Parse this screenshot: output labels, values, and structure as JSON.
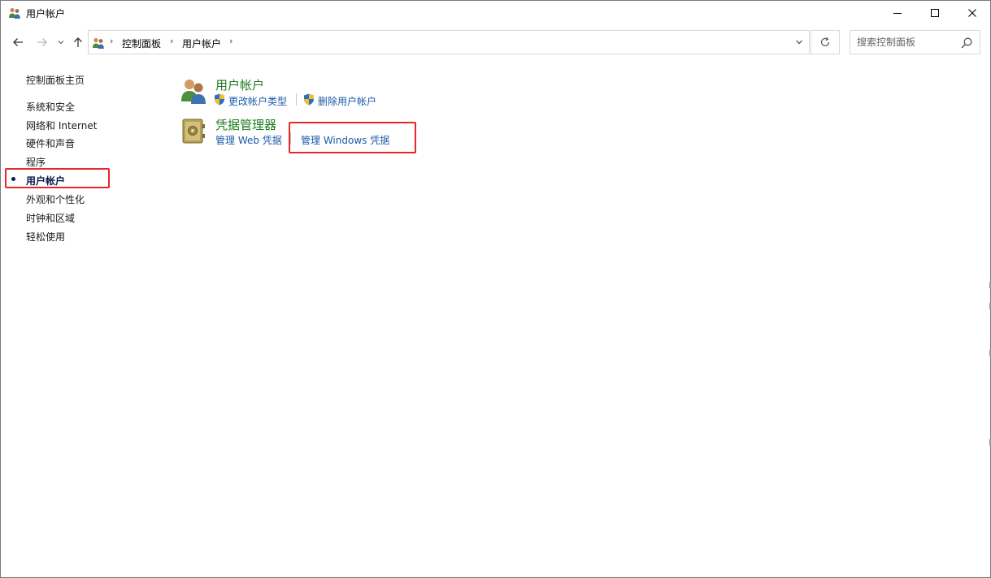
{
  "window": {
    "title": "用户帐户",
    "minimize_icon": "minimize-icon",
    "maximize_icon": "maximize-icon",
    "close_icon": "close-icon"
  },
  "navigation": {
    "back_icon": "arrow-left-icon",
    "forward_icon": "arrow-right-icon",
    "recent_icon": "chevron-down-icon",
    "up_icon": "arrow-up-icon"
  },
  "address_bar": {
    "breadcrumbs": [
      "控制面板",
      "用户帐户"
    ],
    "dropdown_icon": "chevron-down-icon",
    "refresh_icon": "refresh-icon"
  },
  "search": {
    "placeholder": "搜索控制面板"
  },
  "sidebar": {
    "home": "控制面板主页",
    "items": [
      {
        "label": "系统和安全"
      },
      {
        "label": "网络和 Internet"
      },
      {
        "label": "硬件和声音"
      },
      {
        "label": "程序"
      },
      {
        "label": "用户帐户",
        "active": true
      },
      {
        "label": "外观和个性化"
      },
      {
        "label": "时钟和区域"
      },
      {
        "label": "轻松使用"
      }
    ]
  },
  "main": {
    "categories": [
      {
        "title": "用户帐户",
        "icon": "users-icon",
        "links": [
          {
            "label": "更改帐户类型",
            "icon": "shield-icon"
          },
          {
            "label": "删除用户帐户",
            "icon": "shield-icon"
          }
        ]
      },
      {
        "title": "凭据管理器",
        "icon": "credential-vault-icon",
        "links": [
          {
            "label": "管理 Web 凭据"
          },
          {
            "label": "管理 Windows 凭据"
          }
        ]
      }
    ]
  },
  "colors": {
    "category_title": "#1e7b1e",
    "link": "#1a5aa8",
    "highlight_box": "#e6262b"
  }
}
